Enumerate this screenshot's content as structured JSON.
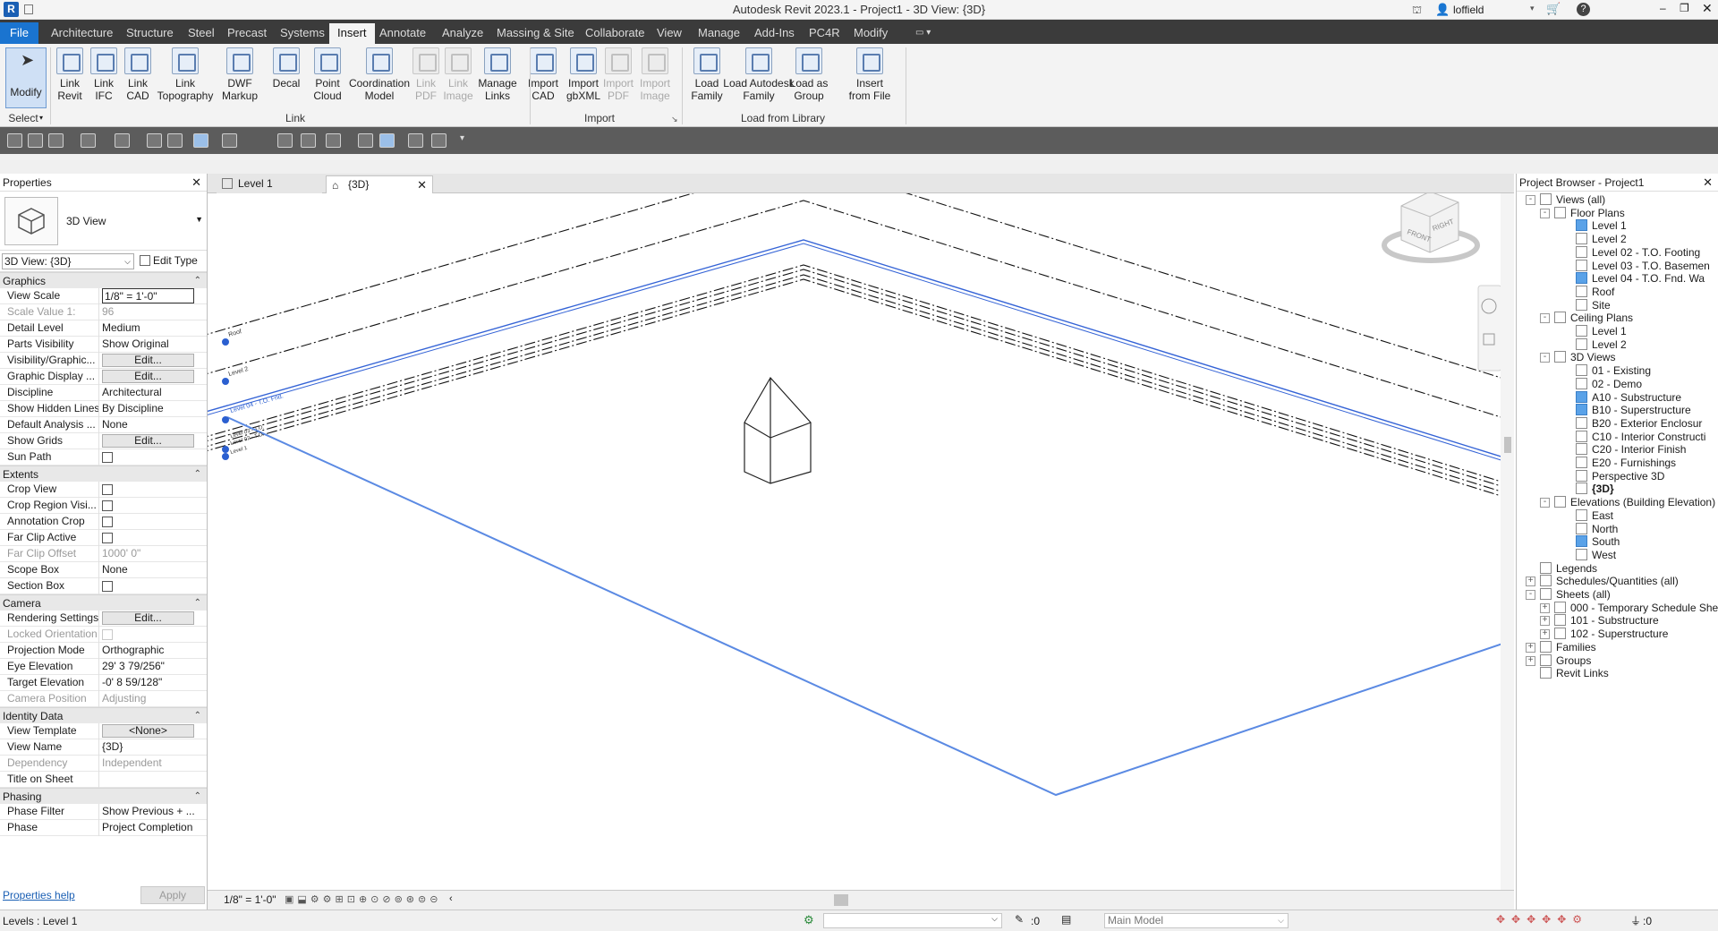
{
  "app": {
    "title": "Autodesk Revit 2023.1 - Project1 - 3D View: {3D}",
    "user": "loffield"
  },
  "ribbon_tabs": [
    "File",
    "Architecture",
    "Structure",
    "Steel",
    "Precast",
    "Systems",
    "Insert",
    "Annotate",
    "Analyze",
    "Massing & Site",
    "Collaborate",
    "View",
    "Manage",
    "Add-Ins",
    "PC4R",
    "Modify"
  ],
  "active_tab": "Insert",
  "ribbon": {
    "select": {
      "btn": "Modify",
      "panel": "Select"
    },
    "link_panel": "Link",
    "import_panel": "Import",
    "library_panel": "Load from Library",
    "buttons": [
      {
        "l1": "Link",
        "l2": "Revit",
        "dis": false
      },
      {
        "l1": "Link",
        "l2": "IFC",
        "dis": false
      },
      {
        "l1": "Link",
        "l2": "CAD",
        "dis": false
      },
      {
        "l1": "Link",
        "l2": "Topography",
        "dis": false
      },
      {
        "l1": "DWF",
        "l2": "Markup",
        "dis": false
      },
      {
        "l1": "Decal",
        "l2": "",
        "dis": false
      },
      {
        "l1": "Point",
        "l2": "Cloud",
        "dis": false
      },
      {
        "l1": "Coordination",
        "l2": "Model",
        "dis": false
      },
      {
        "l1": "Link",
        "l2": "PDF",
        "dis": true
      },
      {
        "l1": "Link",
        "l2": "Image",
        "dis": true
      },
      {
        "l1": "Manage",
        "l2": "Links",
        "dis": false
      },
      {
        "l1": "Import",
        "l2": "CAD",
        "dis": false
      },
      {
        "l1": "Import",
        "l2": "gbXML",
        "dis": false
      },
      {
        "l1": "Import",
        "l2": "PDF",
        "dis": true
      },
      {
        "l1": "Import",
        "l2": "Image",
        "dis": true
      },
      {
        "l1": "Load",
        "l2": "Family",
        "dis": false
      },
      {
        "l1": "Load Autodesk",
        "l2": "Family",
        "dis": false
      },
      {
        "l1": "Load as",
        "l2": "Group",
        "dis": false
      },
      {
        "l1": "Insert",
        "l2": "from File",
        "dis": false
      }
    ]
  },
  "properties": {
    "title": "Properties",
    "type_name": "3D View",
    "instance": "3D View: {3D}",
    "edit_type": "Edit Type",
    "sections": [
      {
        "name": "Graphics",
        "rows": [
          {
            "k": "View Scale",
            "v": "1/8\" = 1'-0\"",
            "t": "inp"
          },
          {
            "k": "Scale Value    1:",
            "v": "96",
            "dim": true
          },
          {
            "k": "Detail Level",
            "v": "Medium"
          },
          {
            "k": "Parts Visibility",
            "v": "Show Original"
          },
          {
            "k": "Visibility/Graphic...",
            "v": "Edit...",
            "t": "btn"
          },
          {
            "k": "Graphic Display ...",
            "v": "Edit...",
            "t": "btn"
          },
          {
            "k": "Discipline",
            "v": "Architectural"
          },
          {
            "k": "Show Hidden Lines",
            "v": "By Discipline"
          },
          {
            "k": "Default Analysis ...",
            "v": "None"
          },
          {
            "k": "Show Grids",
            "v": "Edit...",
            "t": "btn"
          },
          {
            "k": "Sun Path",
            "v": "",
            "t": "cb"
          }
        ]
      },
      {
        "name": "Extents",
        "rows": [
          {
            "k": "Crop View",
            "v": "",
            "t": "cb"
          },
          {
            "k": "Crop Region Visi...",
            "v": "",
            "t": "cb"
          },
          {
            "k": "Annotation Crop",
            "v": "",
            "t": "cb"
          },
          {
            "k": "Far Clip Active",
            "v": "",
            "t": "cb"
          },
          {
            "k": "Far Clip Offset",
            "v": "1000'  0\"",
            "dim": true
          },
          {
            "k": "Scope Box",
            "v": "None"
          },
          {
            "k": "Section Box",
            "v": "",
            "t": "cb"
          }
        ]
      },
      {
        "name": "Camera",
        "rows": [
          {
            "k": "Rendering Settings",
            "v": "Edit...",
            "t": "btn"
          },
          {
            "k": "Locked Orientation",
            "v": "",
            "t": "cb",
            "dim": true
          },
          {
            "k": "Projection Mode",
            "v": "Orthographic"
          },
          {
            "k": "Eye Elevation",
            "v": "29'  3 79/256\""
          },
          {
            "k": "Target Elevation",
            "v": "-0'  8 59/128\""
          },
          {
            "k": "Camera Position",
            "v": "Adjusting",
            "dim": true
          }
        ]
      },
      {
        "name": "Identity Data",
        "rows": [
          {
            "k": "View Template",
            "v": "<None>",
            "t": "btn"
          },
          {
            "k": "View Name",
            "v": "{3D}"
          },
          {
            "k": "Dependency",
            "v": "Independent",
            "dim": true
          },
          {
            "k": "Title on Sheet",
            "v": ""
          }
        ]
      },
      {
        "name": "Phasing",
        "rows": [
          {
            "k": "Phase Filter",
            "v": "Show Previous + ..."
          },
          {
            "k": "Phase",
            "v": "Project Completion"
          }
        ]
      }
    ],
    "help": "Properties help",
    "apply": "Apply"
  },
  "view_tabs": [
    {
      "label": "Level 1",
      "active": false
    },
    {
      "label": "{3D}",
      "active": true
    }
  ],
  "view_scale": "1/8\" = 1'-0\"",
  "viewcube": {
    "front": "FRONT",
    "right": "RIGHT"
  },
  "level_tags": [
    "Roof",
    "Level 2",
    "Level 04 - T.O. Fnd.",
    "Level 03 - T.O.",
    "Level 02 - T.O.",
    "Level 1"
  ],
  "browser": {
    "title": "Project Browser - Project1",
    "items": [
      {
        "d": 0,
        "e": "-",
        "label": "Views (all)"
      },
      {
        "d": 1,
        "e": "-",
        "label": "Floor Plans"
      },
      {
        "d": 2,
        "label": "Level 1",
        "hl": true
      },
      {
        "d": 2,
        "label": "Level 2"
      },
      {
        "d": 2,
        "label": "Level 02 - T.O. Footing"
      },
      {
        "d": 2,
        "label": "Level 03 - T.O. Basemen"
      },
      {
        "d": 2,
        "label": "Level 04 - T.O. Fnd. Wa",
        "hl": true
      },
      {
        "d": 2,
        "label": "Roof"
      },
      {
        "d": 2,
        "label": "Site"
      },
      {
        "d": 1,
        "e": "-",
        "label": "Ceiling Plans"
      },
      {
        "d": 2,
        "label": "Level 1"
      },
      {
        "d": 2,
        "label": "Level 2"
      },
      {
        "d": 1,
        "e": "-",
        "label": "3D Views"
      },
      {
        "d": 2,
        "label": "01 - Existing"
      },
      {
        "d": 2,
        "label": "02 - Demo"
      },
      {
        "d": 2,
        "label": "A10 - Substructure",
        "hl": true
      },
      {
        "d": 2,
        "label": "B10 - Superstructure",
        "hl": true
      },
      {
        "d": 2,
        "label": "B20 - Exterior Enclosur"
      },
      {
        "d": 2,
        "label": "C10 - Interior Constructi"
      },
      {
        "d": 2,
        "label": "C20 - Interior Finish"
      },
      {
        "d": 2,
        "label": "E20 - Furnishings"
      },
      {
        "d": 2,
        "label": "Perspective 3D"
      },
      {
        "d": 2,
        "label": "{3D}",
        "bold": true
      },
      {
        "d": 1,
        "e": "-",
        "label": "Elevations (Building Elevation)"
      },
      {
        "d": 2,
        "label": "East"
      },
      {
        "d": 2,
        "label": "North"
      },
      {
        "d": 2,
        "label": "South",
        "hl": true
      },
      {
        "d": 2,
        "label": "West"
      },
      {
        "d": 0,
        "label": "Legends"
      },
      {
        "d": 0,
        "e": "+",
        "label": "Schedules/Quantities (all)"
      },
      {
        "d": 0,
        "e": "-",
        "label": "Sheets (all)"
      },
      {
        "d": 1,
        "e": "+",
        "label": "000 - Temporary Schedule Shee"
      },
      {
        "d": 1,
        "e": "+",
        "label": "101 - Substructure"
      },
      {
        "d": 1,
        "e": "+",
        "label": "102 - Superstructure"
      },
      {
        "d": 0,
        "e": "+",
        "label": "Families"
      },
      {
        "d": 0,
        "e": "+",
        "label": "Groups"
      },
      {
        "d": 0,
        "label": "Revit Links"
      }
    ]
  },
  "status": {
    "text": "Levels : Level 1",
    "count": ":0",
    "model": "Main Model",
    "filter": ":0"
  }
}
